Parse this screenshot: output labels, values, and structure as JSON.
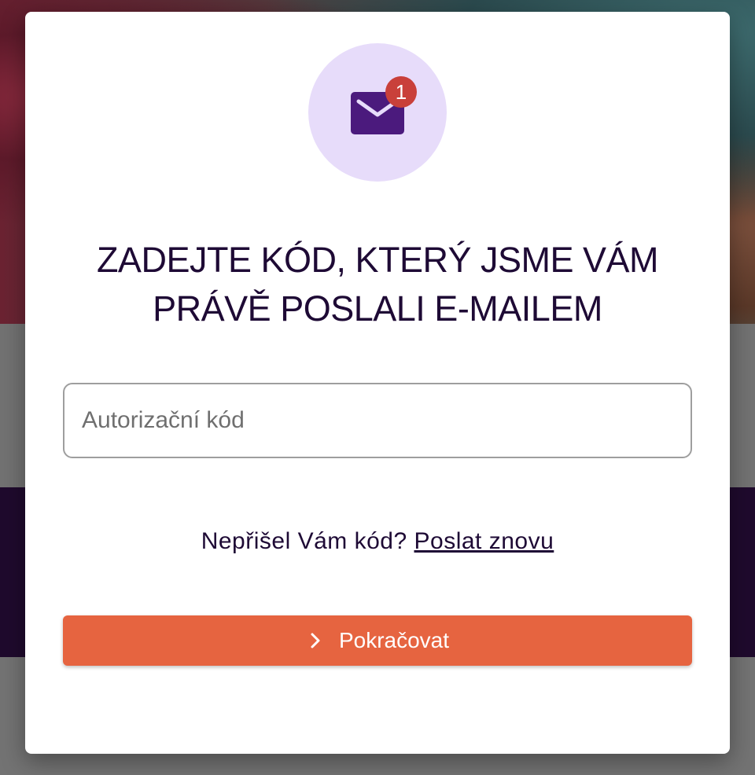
{
  "modal": {
    "badge_count": "1",
    "icon": "mail-icon",
    "title": "ZADEJTE KÓD, KTERÝ JSME VÁM PRÁVĚ POSLALI E-MAILEM",
    "code_input": {
      "placeholder": "Autorizační kód",
      "value": ""
    },
    "resend": {
      "text": "Nepřišel Vám kód?",
      "link_label": "Poslat znovu"
    },
    "continue_button": {
      "label": "Pokračovat",
      "icon": "chevron-right-icon"
    }
  },
  "colors": {
    "accent": "#e66440",
    "primary_text": "#1e0a35",
    "icon_purple": "#4b1a7d",
    "icon_bg": "#e7dcfa",
    "badge": "#c9403a"
  }
}
